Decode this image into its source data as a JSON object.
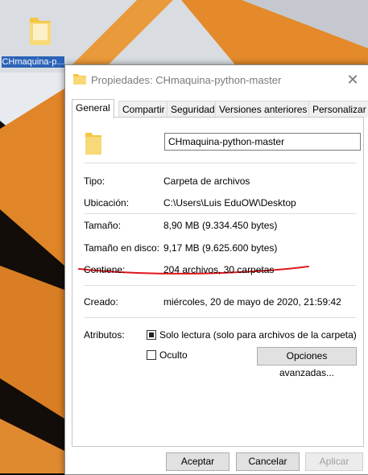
{
  "desktop": {
    "icon_label": "CHmaquina-p..."
  },
  "dialog": {
    "title": "Propiedades: CHmaquina-python-master",
    "tabs": [
      "General",
      "Compartir",
      "Seguridad",
      "Versiones anteriores",
      "Personalizar"
    ],
    "active_tab": "General",
    "name_value": "CHmaquina-python-master",
    "properties": {
      "tipo_label": "Tipo:",
      "tipo_value": "Carpeta de archivos",
      "ubicacion_label": "Ubicación:",
      "ubicacion_value": "C:\\Users\\Luis EduOW\\Desktop",
      "tamano_label": "Tamaño:",
      "tamano_value": "8,90 MB (9.334.450 bytes)",
      "tamano_disco_label": "Tamaño en disco:",
      "tamano_disco_value": "9,17 MB (9.625.600 bytes)",
      "contiene_label": "Contiene:",
      "contiene_value": "204 archivos, 30 carpetas",
      "creado_label": "Creado:",
      "creado_value": "miércoles, 20 de mayo de 2020, 21:59:42",
      "atributos_label": "Atributos:",
      "solo_lectura_label": "Solo lectura (solo para archivos de la carpeta)",
      "oculto_label": "Oculto",
      "opciones_avanzadas_label": "Opciones avanzadas..."
    },
    "footer": {
      "aceptar": "Aceptar",
      "cancelar": "Cancelar",
      "aplicar": "Aplicar"
    }
  },
  "colors": {
    "annotation_underline": "#e0141b",
    "folder_yellow": "#f5c542",
    "wallpaper_orange": "#e48a2a"
  }
}
